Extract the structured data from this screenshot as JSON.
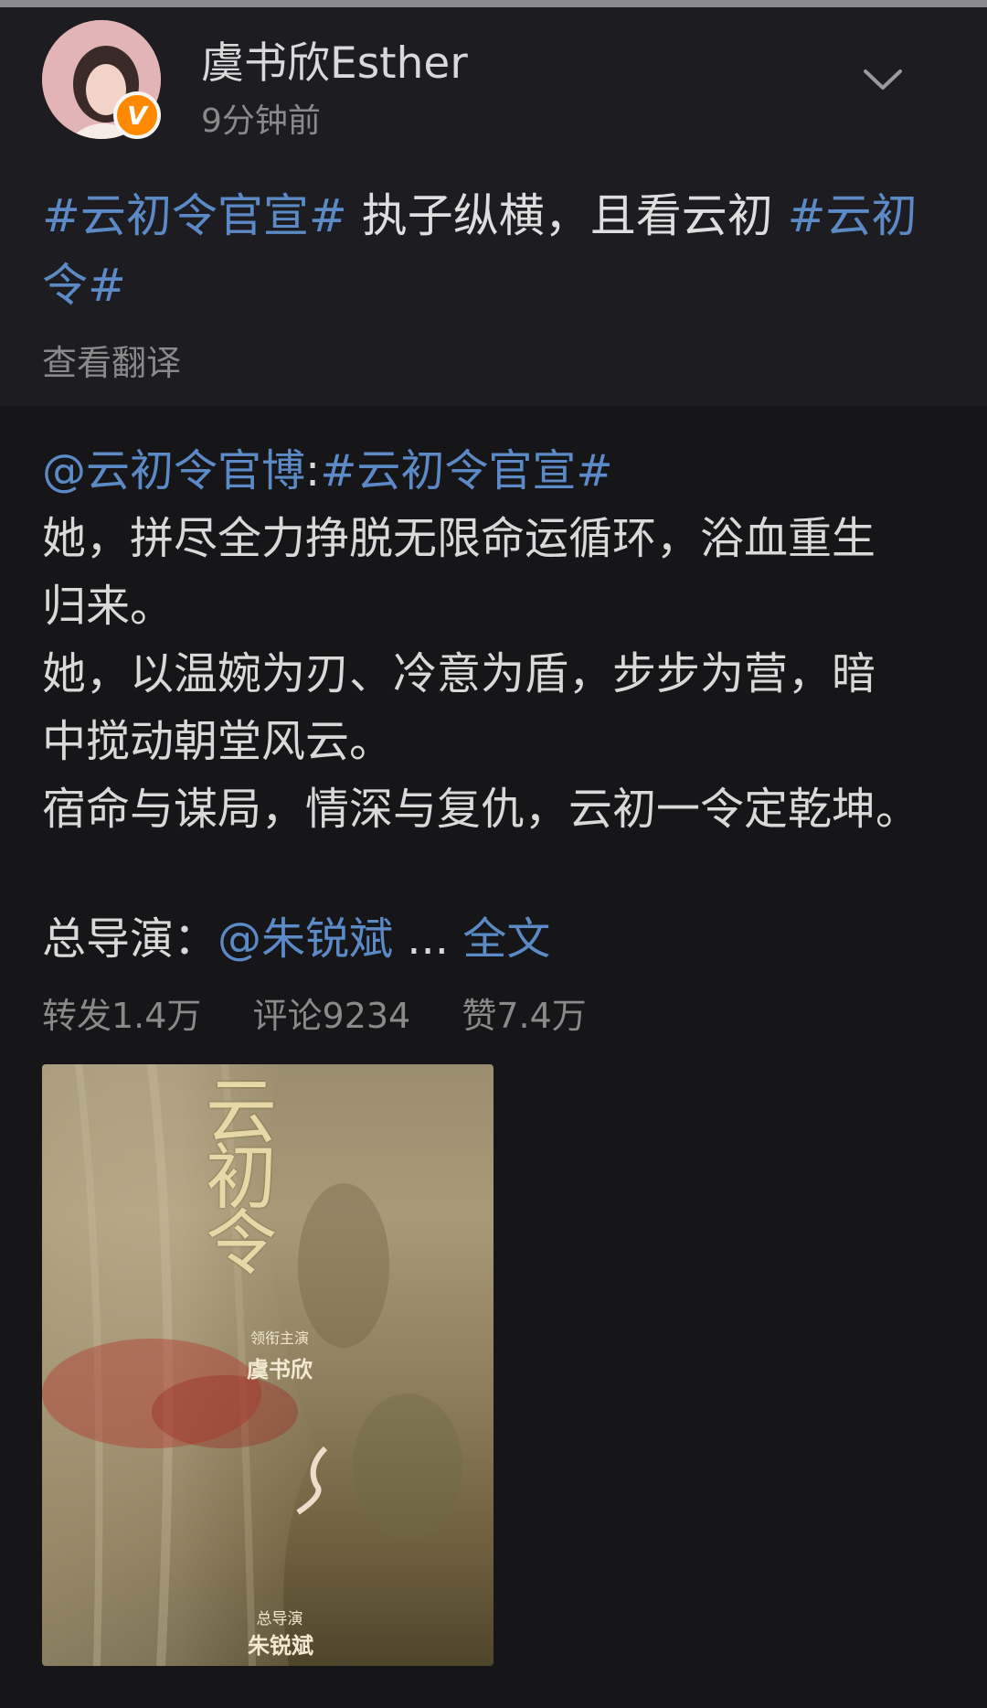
{
  "post": {
    "author": "虞书欣Esther",
    "time": "9分钟前",
    "verified_badge": "V",
    "text": {
      "tag1": "#云初令官宣#",
      "body": " 执子纵横，且看云初 ",
      "tag2": "#云初令#"
    },
    "translate_label": "查看翻译"
  },
  "repost": {
    "mention": "@云初令官博",
    "colon": ":",
    "tag": "#云初令官宣#",
    "lines": [
      "她，拼尽全力挣脱无限命运循环，浴血重生",
      "归来。",
      "她，以温婉为刃、冷意为盾，步步为营，暗",
      "中搅动朝堂风云。",
      "宿命与谋局，情深与复仇，云初一令定乾坤。"
    ],
    "credit_label": "总导演：",
    "credit_mention": "@朱锐斌",
    "ellipsis": " ... ",
    "full_text_link": "全文",
    "stats": {
      "reposts": "转发1.4万",
      "comments": "评论9234",
      "likes": "赞7.4万"
    },
    "poster": {
      "title": "云初令",
      "lead_label": "领衔主演",
      "lead_name": "虞书欣",
      "director_label": "总导演",
      "director_name": "朱锐斌"
    }
  },
  "icons": {
    "chevron": "chevron-down-icon",
    "badge": "verified-badge-icon"
  },
  "colors": {
    "link": "#5b8ac6",
    "background": "#1d1d21",
    "repost_background": "#161619",
    "badge": "#ff8a00"
  }
}
